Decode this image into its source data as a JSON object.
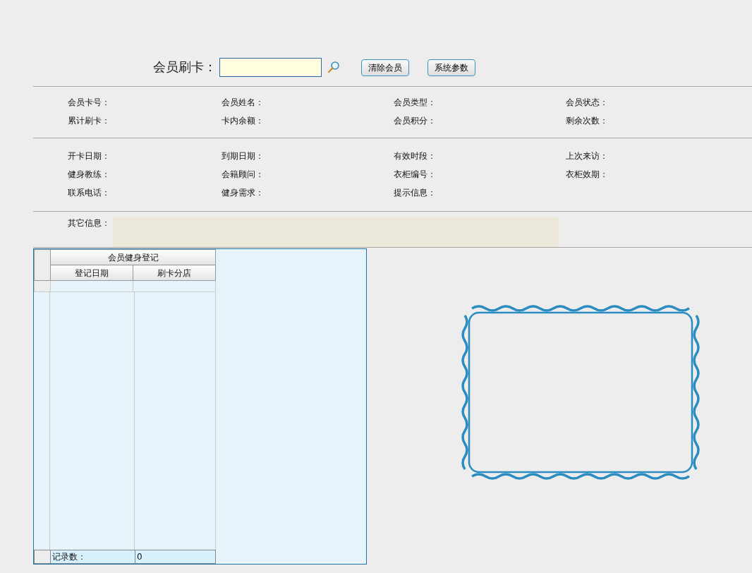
{
  "swipe_bar": {
    "label": "会员刷卡：",
    "buttons": [
      "清除会员",
      "系统参数"
    ]
  },
  "info_sections": [
    {
      "fields": [
        "会员卡号：",
        "会员姓名：",
        "会员类型：",
        "会员状态：",
        "累计刷卡：",
        "卡内余额：",
        "会员积分：",
        "剩余次数："
      ]
    },
    {
      "fields": [
        "开卡日期：",
        "到期日期：",
        "有效时段：",
        "上次来访：",
        "健身教练：",
        "会籍顾问：",
        "衣柜编号：",
        "衣柜效期：",
        "联系电话：",
        "健身需求：",
        "提示信息："
      ]
    }
  ],
  "other_info": {
    "label": "其它信息："
  },
  "grid": {
    "group_header": "会员健身登记",
    "columns": [
      "登记日期",
      "刷卡分店"
    ],
    "footer": {
      "label": "记录数：",
      "value": "0"
    }
  }
}
